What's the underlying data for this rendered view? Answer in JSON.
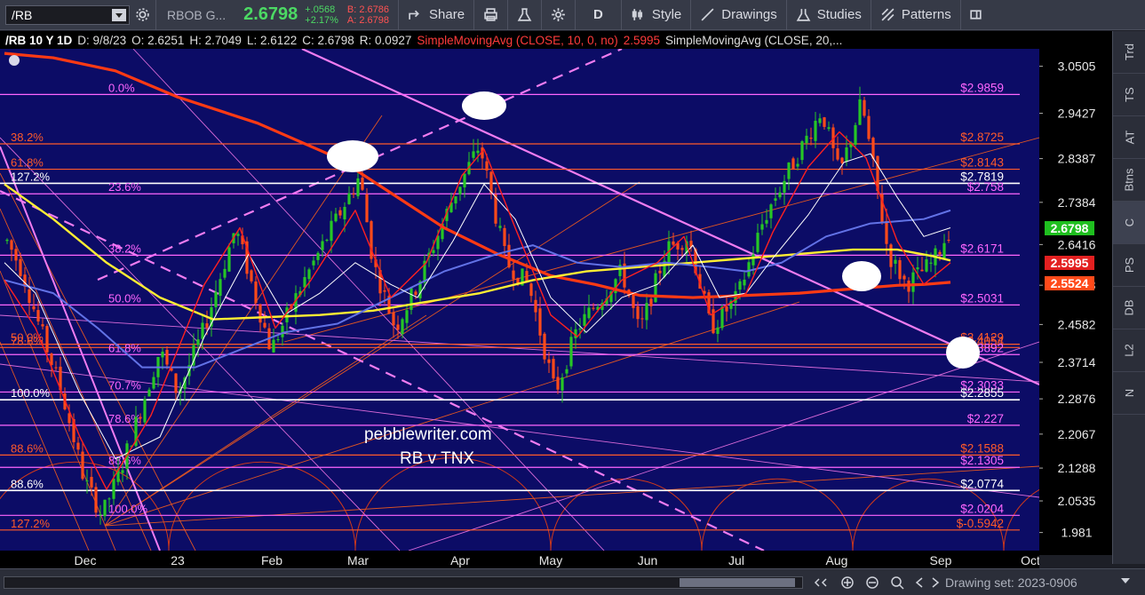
{
  "toolbar": {
    "symbol": "/RB",
    "quote_name": "RBOB G...",
    "last": "2.6798",
    "change": "+.0568",
    "change_pct": "+2.17%",
    "bid": "B: 2.6786",
    "ask": "A: 2.6798",
    "share_label": "Share",
    "period_label": "D",
    "style_label": "Style",
    "drawings_label": "Drawings",
    "studies_label": "Studies",
    "patterns_label": "Patterns"
  },
  "infobar": {
    "title": "/RB 10 Y 1D",
    "date": "D: 9/8/23",
    "open": "O: 2.6251",
    "high": "H: 2.7049",
    "low": "L: 2.6122",
    "close": "C: 2.6798",
    "range": "R: 0.0927",
    "sma10": "SimpleMovingAvg (CLOSE, 10, 0, no)",
    "sma10_value": "2.5995",
    "sma20": "SimpleMovingAvg (CLOSE, 20,..."
  },
  "right_tabs": [
    "Trd",
    "TS",
    "AT",
    "Btns",
    "C",
    "PS",
    "DB",
    "L2",
    "N"
  ],
  "bottombar": {
    "drawing_set": "Drawing set: 2023-0906"
  },
  "colors": {
    "background": "#0c0c66",
    "up_candle": "#26c626",
    "down_candle": "#ff4a1a",
    "sma_red_10": "#ff2020",
    "sma_white_20": "#ffffff",
    "sma_blue_50": "#5a6ad8",
    "sma_yellow_100": "#ffee33",
    "sma_orange_200": "#ff4a1a",
    "fib_magenta": "#ff66ff",
    "fib_orange": "#ff5a2a",
    "price_tag_green": "#1fbf1f",
    "price_tag_red": "#e32020",
    "price_tag_orange": "#ff4a1a"
  },
  "chart_data": {
    "type": "candlestick",
    "ylim": [
      1.9395,
      3.0905
    ],
    "y_ticks": [
      "3.0505",
      "2.9427",
      "2.8387",
      "2.7384",
      "2.6416",
      "2.5483",
      "2.4582",
      "2.3714",
      "2.2876",
      "2.2067",
      "2.1288",
      "2.0535",
      "1.981"
    ],
    "x_ticks": [
      "Dec",
      "23",
      "Feb",
      "Mar",
      "Apr",
      "May",
      "Jun",
      "Jul",
      "Aug",
      "Sep",
      "Oct"
    ],
    "price_tags": [
      {
        "value": "2.6798",
        "price": 2.6798,
        "color": "#1fbf1f"
      },
      {
        "value": "2.5995",
        "price": 2.5995,
        "color": "#e32020"
      },
      {
        "value": "2.5524",
        "price": 2.5524,
        "color": "#ff4a1a"
      }
    ],
    "annotations": {
      "watermark_line1": "pebblewriter.com",
      "watermark_line2": "RB v TNX"
    },
    "fib_levels": [
      {
        "left": "0.0%",
        "right": "$2.9859",
        "price": 2.9859,
        "color": "#ff66ff",
        "lx": 122
      },
      {
        "left": "38.2%",
        "right": "$2.8725",
        "price": 2.8725,
        "color": "#ff5a2a",
        "lx": 12
      },
      {
        "left": "61.8%",
        "right": "$2.8143",
        "price": 2.8143,
        "color": "#ff5a2a",
        "lx": 12
      },
      {
        "left": "127.2%",
        "right": "$2.7819",
        "price": 2.7819,
        "color": "#ffffff",
        "lx": 12
      },
      {
        "left": "23.6%",
        "right": "$2.758",
        "price": 2.758,
        "color": "#ff66ff",
        "lx": 122
      },
      {
        "left": "38.2%",
        "right": "$2.6171",
        "price": 2.6171,
        "color": "#ff66ff",
        "lx": 122
      },
      {
        "left": "50.0%",
        "right": "$2.5031",
        "price": 2.5031,
        "color": "#ff66ff",
        "lx": 122
      },
      {
        "left": "50.0%",
        "right": "$2.4129",
        "price": 2.4129,
        "color": "#ff5a2a",
        "lx": 12
      },
      {
        "left": "78.6%",
        "right": "$2.4054",
        "price": 2.4054,
        "color": "#ff5a2a",
        "lx": 12
      },
      {
        "left": "61.8%",
        "right": "$2.3892",
        "price": 2.3892,
        "color": "#ff66ff",
        "lx": 122
      },
      {
        "left": "70.7%",
        "right": "$2.3033",
        "price": 2.3033,
        "color": "#ff66ff",
        "lx": 122
      },
      {
        "left": "100.0%",
        "right": "$2.2855",
        "price": 2.2855,
        "color": "#ffffff",
        "lx": 12
      },
      {
        "left": "78.6%",
        "right": "$2.227",
        "price": 2.227,
        "color": "#ff66ff",
        "lx": 122
      },
      {
        "left": "88.6%",
        "right": "$2.1588",
        "price": 2.1588,
        "color": "#ff5a2a",
        "lx": 12
      },
      {
        "left": "88.6%",
        "right": "$2.1305",
        "price": 2.1305,
        "color": "#ff66ff",
        "lx": 122
      },
      {
        "left": "88.6%",
        "right": "$2.0774",
        "price": 2.0774,
        "color": "#ffffff",
        "lx": 12
      },
      {
        "left": "100.0%",
        "right": "$2.0204",
        "price": 2.0204,
        "color": "#ff66ff",
        "lx": 122
      },
      {
        "left": "127.2%",
        "right": "$-0.5942",
        "price": 1.9867,
        "color": "#ff5a2a",
        "lx": 12
      }
    ],
    "sma_paths": {
      "sma200": [
        [
          3.08,
          5
        ],
        [
          3.07,
          60
        ],
        [
          3.04,
          130
        ],
        [
          2.98,
          200
        ],
        [
          2.92,
          290
        ],
        [
          2.84,
          380
        ],
        [
          2.76,
          440
        ],
        [
          2.68,
          500
        ],
        [
          2.62,
          560
        ],
        [
          2.57,
          620
        ],
        [
          2.55,
          670
        ],
        [
          2.525,
          720
        ],
        [
          2.52,
          780
        ],
        [
          2.525,
          840
        ],
        [
          2.53,
          900
        ],
        [
          2.54,
          960
        ],
        [
          2.548,
          1010
        ],
        [
          2.55,
          1040
        ],
        [
          2.555,
          1070
        ]
      ],
      "sma100": [
        [
          2.78,
          5
        ],
        [
          2.7,
          60
        ],
        [
          2.6,
          120
        ],
        [
          2.52,
          180
        ],
        [
          2.47,
          240
        ],
        [
          2.475,
          300
        ],
        [
          2.48,
          360
        ],
        [
          2.49,
          420
        ],
        [
          2.51,
          480
        ],
        [
          2.53,
          540
        ],
        [
          2.56,
          600
        ],
        [
          2.58,
          660
        ],
        [
          2.59,
          720
        ],
        [
          2.6,
          780
        ],
        [
          2.61,
          840
        ],
        [
          2.62,
          900
        ],
        [
          2.63,
          960
        ],
        [
          2.63,
          1010
        ],
        [
          2.615,
          1050
        ],
        [
          2.605,
          1070
        ]
      ],
      "sma50": [
        [
          2.56,
          5
        ],
        [
          2.53,
          60
        ],
        [
          2.45,
          110
        ],
        [
          2.36,
          160
        ],
        [
          2.36,
          220
        ],
        [
          2.4,
          270
        ],
        [
          2.44,
          320
        ],
        [
          2.46,
          380
        ],
        [
          2.52,
          440
        ],
        [
          2.58,
          500
        ],
        [
          2.62,
          560
        ],
        [
          2.64,
          600
        ],
        [
          2.6,
          650
        ],
        [
          2.59,
          700
        ],
        [
          2.6,
          750
        ],
        [
          2.59,
          800
        ],
        [
          2.58,
          840
        ],
        [
          2.6,
          880
        ],
        [
          2.66,
          930
        ],
        [
          2.69,
          980
        ],
        [
          2.7,
          1040
        ],
        [
          2.72,
          1070
        ]
      ],
      "sma20": [
        [
          2.6,
          5
        ],
        [
          2.53,
          40
        ],
        [
          2.3,
          90
        ],
        [
          2.15,
          130
        ],
        [
          2.2,
          180
        ],
        [
          2.43,
          230
        ],
        [
          2.62,
          280
        ],
        [
          2.48,
          320
        ],
        [
          2.53,
          360
        ],
        [
          2.6,
          400
        ],
        [
          2.55,
          440
        ],
        [
          2.52,
          470
        ],
        [
          2.65,
          510
        ],
        [
          2.78,
          545
        ],
        [
          2.7,
          580
        ],
        [
          2.52,
          620
        ],
        [
          2.44,
          660
        ],
        [
          2.52,
          700
        ],
        [
          2.55,
          740
        ],
        [
          2.64,
          780
        ],
        [
          2.52,
          810
        ],
        [
          2.53,
          840
        ],
        [
          2.61,
          870
        ],
        [
          2.71,
          910
        ],
        [
          2.83,
          950
        ],
        [
          2.85,
          980
        ],
        [
          2.75,
          1010
        ],
        [
          2.66,
          1040
        ],
        [
          2.68,
          1070
        ]
      ],
      "sma10": [
        [
          2.56,
          5
        ],
        [
          2.45,
          40
        ],
        [
          2.2,
          90
        ],
        [
          2.08,
          120
        ],
        [
          2.25,
          170
        ],
        [
          2.55,
          230
        ],
        [
          2.68,
          270
        ],
        [
          2.45,
          310
        ],
        [
          2.56,
          350
        ],
        [
          2.72,
          400
        ],
        [
          2.52,
          440
        ],
        [
          2.6,
          480
        ],
        [
          2.8,
          520
        ],
        [
          2.86,
          545
        ],
        [
          2.68,
          580
        ],
        [
          2.48,
          620
        ],
        [
          2.43,
          650
        ],
        [
          2.56,
          700
        ],
        [
          2.6,
          740
        ],
        [
          2.66,
          770
        ],
        [
          2.48,
          800
        ],
        [
          2.53,
          840
        ],
        [
          2.67,
          870
        ],
        [
          2.82,
          910
        ],
        [
          2.9,
          945
        ],
        [
          2.84,
          975
        ],
        [
          2.65,
          1010
        ],
        [
          2.55,
          1040
        ],
        [
          2.6,
          1070
        ]
      ]
    },
    "price_path": [
      [
        2.65,
        8
      ],
      [
        2.58,
        25
      ],
      [
        2.45,
        45
      ],
      [
        2.3,
        70
      ],
      [
        2.1,
        95
      ],
      [
        2.02,
        115
      ],
      [
        2.15,
        140
      ],
      [
        2.4,
        180
      ],
      [
        2.3,
        200
      ],
      [
        2.45,
        230
      ],
      [
        2.68,
        265
      ],
      [
        2.4,
        305
      ],
      [
        2.55,
        340
      ],
      [
        2.8,
        405
      ],
      [
        2.6,
        420
      ],
      [
        2.45,
        445
      ],
      [
        2.55,
        470
      ],
      [
        2.75,
        510
      ],
      [
        2.87,
        540
      ],
      [
        2.6,
        570
      ],
      [
        2.55,
        595
      ],
      [
        2.3,
        625
      ],
      [
        2.45,
        650
      ],
      [
        2.58,
        700
      ],
      [
        2.44,
        720
      ],
      [
        2.63,
        750
      ],
      [
        2.66,
        775
      ],
      [
        2.45,
        800
      ],
      [
        2.52,
        830
      ],
      [
        2.7,
        860
      ],
      [
        2.78,
        880
      ],
      [
        2.95,
        925
      ],
      [
        2.8,
        945
      ],
      [
        2.97,
        970
      ],
      [
        2.62,
        1000
      ],
      [
        2.55,
        1020
      ],
      [
        2.6,
        1050
      ],
      [
        2.68,
        1070
      ]
    ]
  }
}
